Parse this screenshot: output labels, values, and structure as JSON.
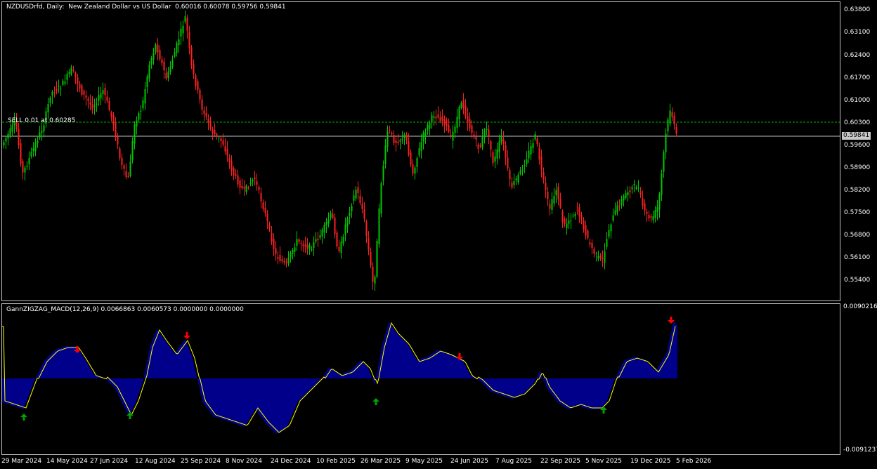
{
  "main": {
    "title": "NZDUSDrfd, Daily:  New Zealand Dollar vs US Dollar  0.60016 0.60078 0.59756 0.59841",
    "order_label": "SELL 0.01 at 0.60285",
    "current_price": "0.59841",
    "price_ticks": [
      "0.63800",
      "0.63100",
      "0.62400",
      "0.61700",
      "0.61000",
      "0.60300",
      "0.59600",
      "0.58900",
      "0.58200",
      "0.57500",
      "0.56800",
      "0.56100",
      "0.55400"
    ]
  },
  "indicator": {
    "title": "GannZIGZAG_MACD(12,26,9) 0.0066863 0.0060573 0.0000000 0.0000000",
    "top_value": "0.0090216",
    "bottom_value": "-0.0091237"
  },
  "time_axis": [
    "29 Mar 2024",
    "14 May 2024",
    "27 Jun 2024",
    "12 Aug 2024",
    "25 Sep 2024",
    "8 Nov 2024",
    "24 Dec 2024",
    "10 Feb 2025",
    "26 Mar 2025",
    "9 May 2025",
    "24 Jun 2025",
    "7 Aug 2025",
    "22 Sep 2025",
    "5 Nov 2025",
    "19 Dec 2025",
    "5 Feb 2026"
  ],
  "colors": {
    "bull": "#00c800",
    "bear": "#ff2020",
    "histogram": "#00008b",
    "signal": "#ffff00",
    "arrow_up": "#00a000",
    "arrow_down": "#ff0000",
    "order_line": "#00b000",
    "price_line": "#c0c0c0"
  },
  "icons": {
    "up": "arrow-up-icon",
    "down": "arrow-down-icon"
  }
}
